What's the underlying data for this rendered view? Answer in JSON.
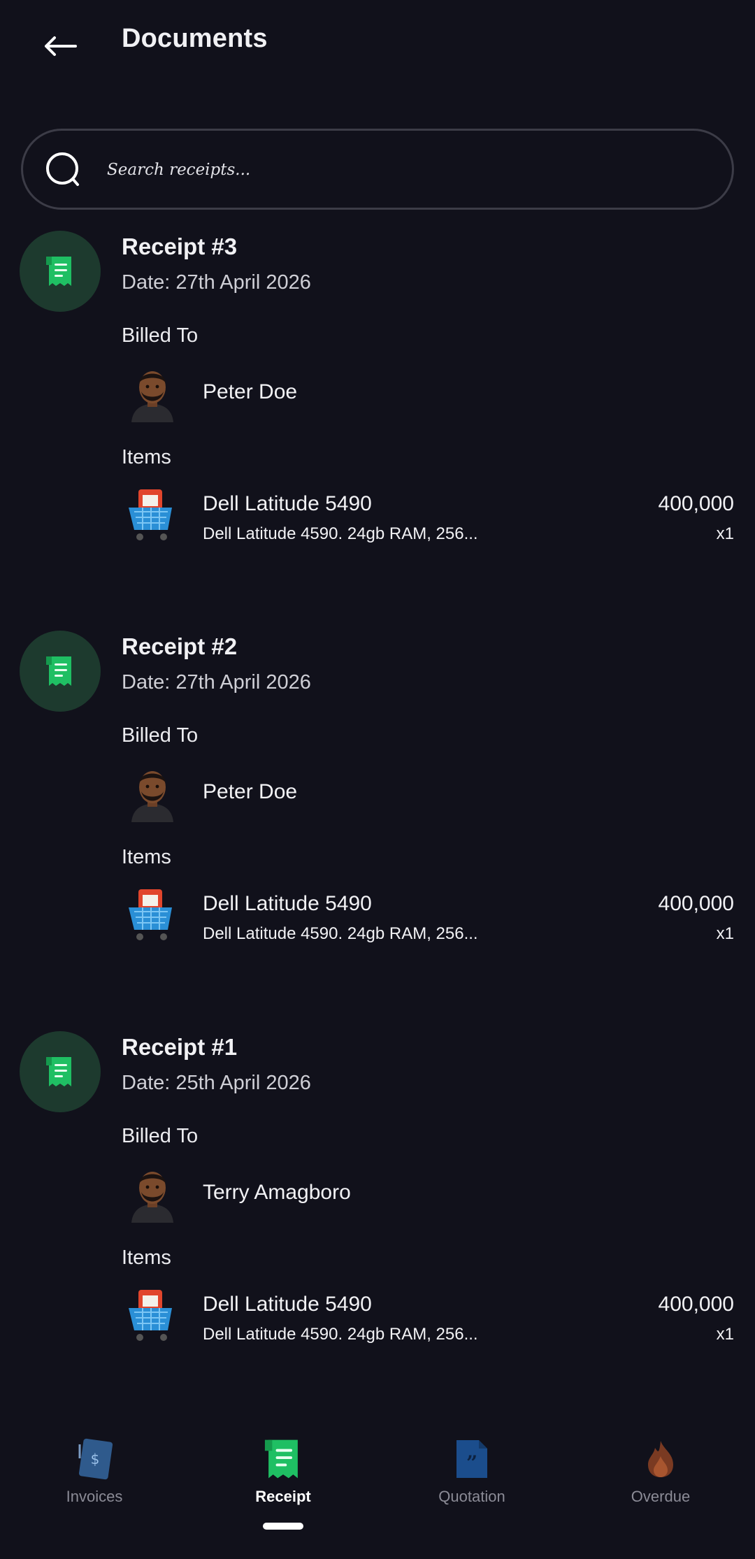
{
  "header": {
    "title": "Documents"
  },
  "search": {
    "placeholder": "Search receipts..."
  },
  "labels": {
    "billed_to": "Billed To",
    "items": "Items"
  },
  "receipts": [
    {
      "title": "Receipt #3",
      "date": "Date: 27th April 2026",
      "customer": "Peter Doe",
      "item": {
        "name": "Dell Latitude 5490",
        "description": "Dell Latitude 4590. 24gb RAM, 256...",
        "price": "400,000",
        "qty": "x1"
      }
    },
    {
      "title": "Receipt #2",
      "date": "Date: 27th April 2026",
      "customer": "Peter Doe",
      "item": {
        "name": "Dell Latitude 5490",
        "description": "Dell Latitude 4590. 24gb RAM, 256...",
        "price": "400,000",
        "qty": "x1"
      }
    },
    {
      "title": "Receipt #1",
      "date": "Date: 25th April 2026",
      "customer": "Terry Amagboro",
      "item": {
        "name": "Dell Latitude 5490",
        "description": "Dell Latitude 4590. 24gb RAM, 256...",
        "price": "400,000",
        "qty": "x1"
      }
    }
  ],
  "nav": {
    "items": [
      {
        "label": "Invoices",
        "icon": "invoice-icon"
      },
      {
        "label": "Receipt",
        "icon": "receipt-icon",
        "active": true
      },
      {
        "label": "Quotation",
        "icon": "quotation-icon"
      },
      {
        "label": "Overdue",
        "icon": "fire-icon"
      }
    ]
  },
  "colors": {
    "background": "#11111b",
    "accent_green": "#1fbf63",
    "badge_bg": "#1d3a2e",
    "muted": "#8b8b96"
  }
}
